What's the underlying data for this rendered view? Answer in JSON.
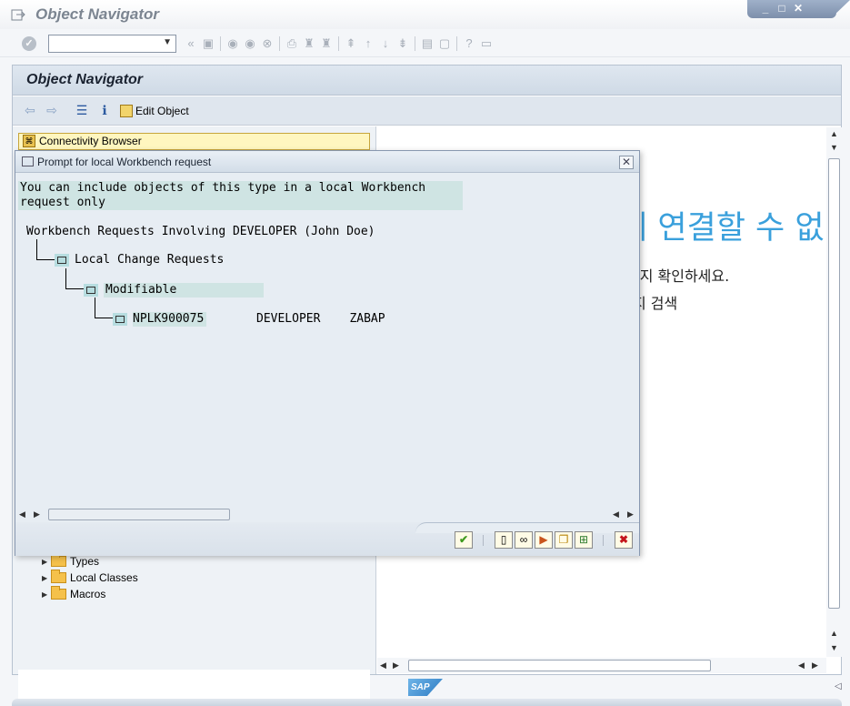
{
  "window": {
    "title": "Object Navigator",
    "controls": [
      "_",
      "□",
      "✕"
    ]
  },
  "system_toolbar": {
    "command_field_value": "",
    "icons": [
      "enter-icon",
      "back-icon",
      "save-icon",
      "back-nav-icon",
      "exit-icon",
      "cancel-icon",
      "print-icon",
      "find-icon",
      "find-next-icon",
      "first-page-icon",
      "prev-page-icon",
      "next-page-icon",
      "last-page-icon",
      "new-session-icon",
      "shortcut-icon",
      "help-icon",
      "customize-layout-icon"
    ]
  },
  "main": {
    "title": "Object Navigator",
    "app_toolbar": {
      "edit_object_label": "Edit Object"
    }
  },
  "left_pane": {
    "connectivity_browser_label": "Connectivity Browser",
    "tree_items": [
      {
        "label": "Types"
      },
      {
        "label": "Local Classes"
      },
      {
        "label": "Macros"
      }
    ]
  },
  "right_pane": {
    "heading_fragment": "에 연결할 수 없",
    "line1_fragment": "르지 확인하세요.",
    "line2_fragment": "지 검색"
  },
  "dialog": {
    "title": "Prompt for local Workbench request",
    "message_line1": "You can include objects of this type in a local Workbench",
    "message_line2": "request only",
    "tree_root": "Workbench Requests Involving DEVELOPER (John Doe)",
    "node_local": "Local Change Requests",
    "node_modifiable": "Modifiable",
    "request": {
      "number": "NPLK900075",
      "owner": "DEVELOPER",
      "description": "ZABAP"
    },
    "buttons": [
      "continue-button",
      "create-request-button",
      "own-requests-button",
      "display-request-button",
      "copy-button",
      "hierarchy-button",
      "cancel-button"
    ]
  },
  "colors": {
    "accent_blue": "#3aa0dc",
    "highlight_teal": "#cfe4e3",
    "title_bar_gray": "#7c8591"
  },
  "branding": "SAP"
}
